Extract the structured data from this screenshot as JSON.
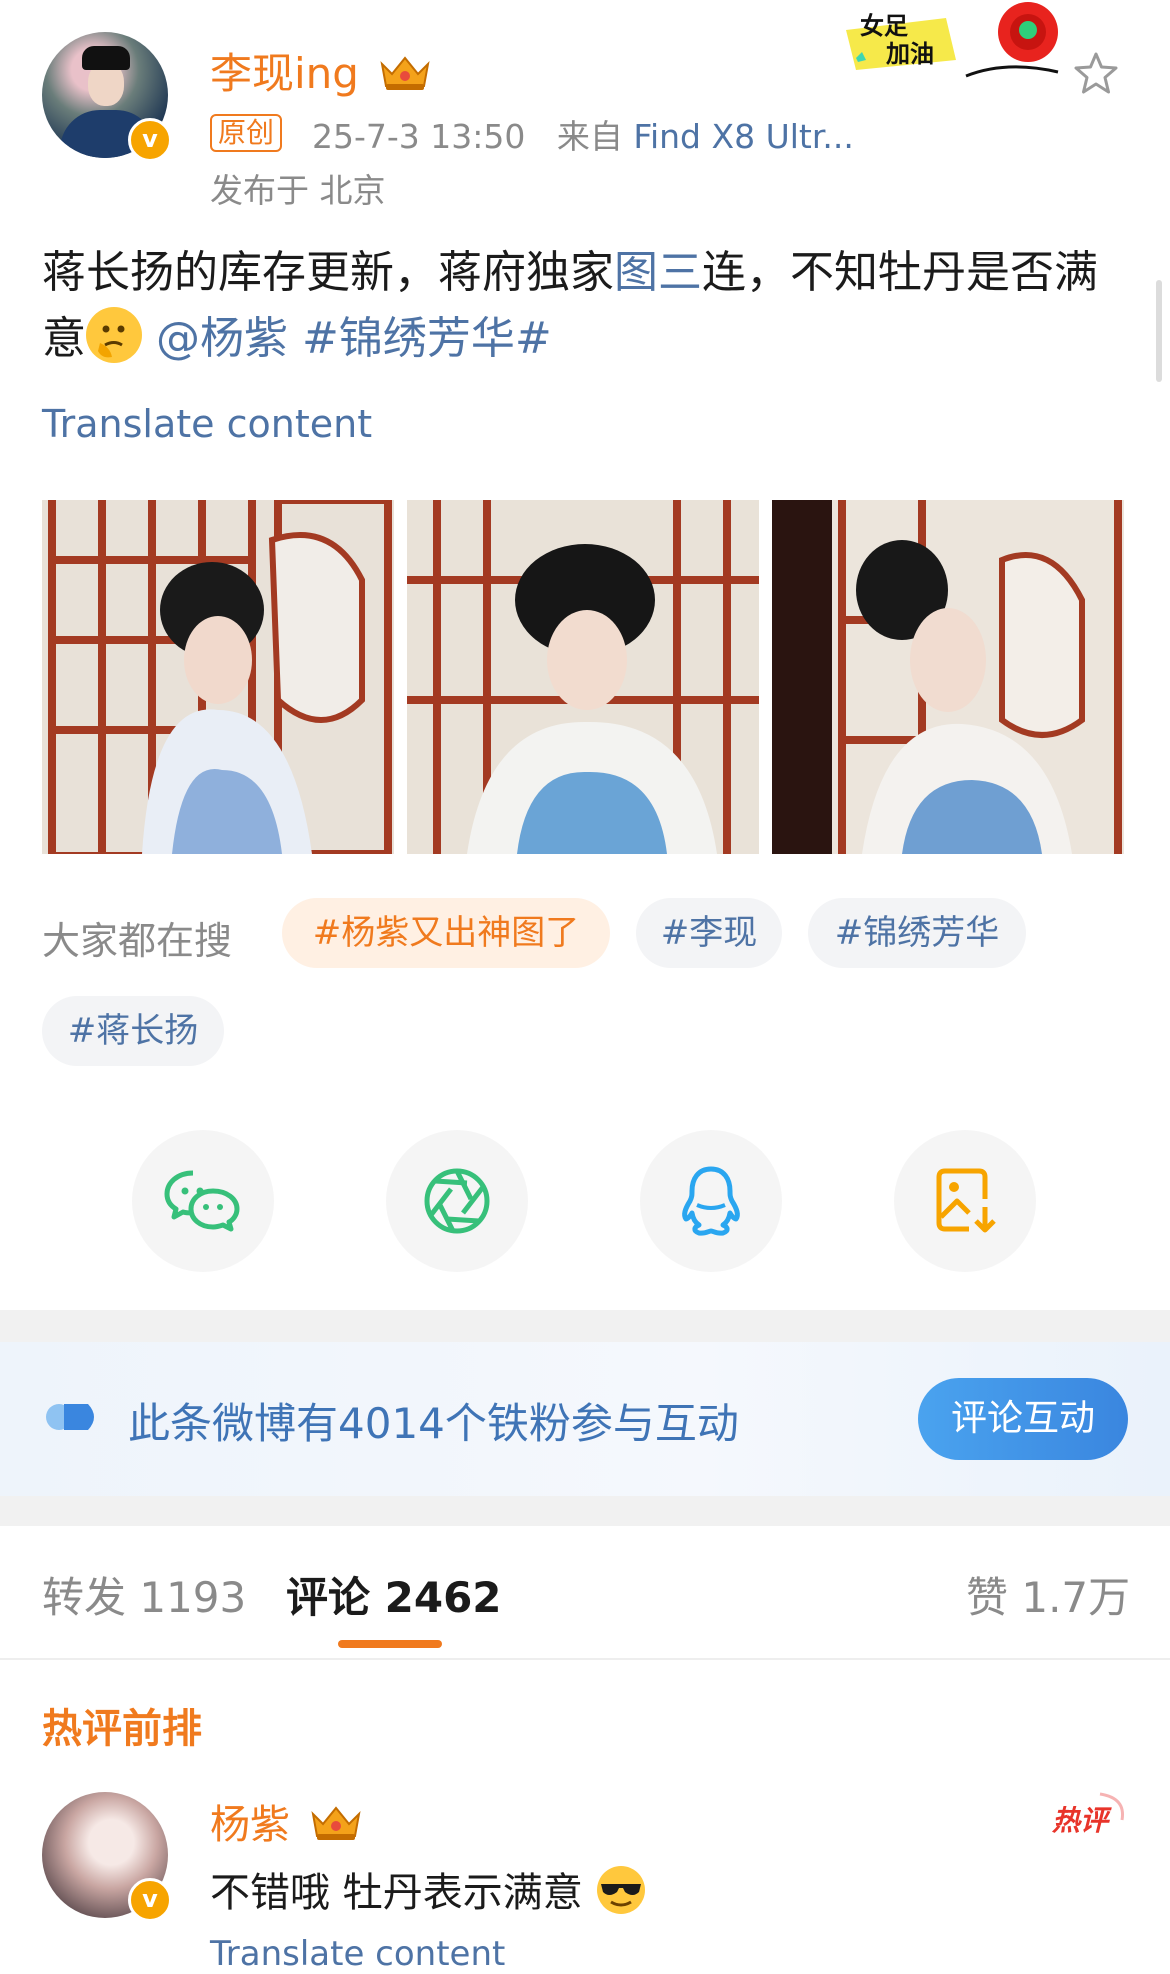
{
  "post": {
    "author": "李现ing",
    "original_label": "原创",
    "time": "25-7-3 13:50",
    "source_prefix": "来自",
    "device": "Find X8 Ultr...",
    "location": "发布于 北京",
    "text_part1": "蒋长扬的库存更新，蒋府独家",
    "text_link": "图三",
    "text_part2": "连，不知牡丹是否满意",
    "mention": "@杨紫",
    "hashtag": "#锦绣芳华#",
    "translate": "Translate content",
    "sticker_line1": "女足",
    "sticker_line2": "加油"
  },
  "search": {
    "lead": "大家都在搜",
    "chips": [
      "#杨紫又出神图了",
      "#李现",
      "#锦绣芳华",
      "#蒋长扬"
    ]
  },
  "share_icons": [
    "wechat-icon",
    "moments-icon",
    "qq-icon",
    "save-image-icon"
  ],
  "fans": {
    "text": "此条微博有4014个铁粉参与互动",
    "button": "评论互动"
  },
  "tabs": {
    "repost": "转发 1193",
    "comment": "评论 2462",
    "like": "赞 1.7万"
  },
  "comments": {
    "section_title": "热评前排",
    "items": [
      {
        "user": "杨紫",
        "text": "不错哦 牡丹表示满意",
        "tag": "热评",
        "translate": "Translate content"
      }
    ]
  },
  "colors": {
    "accent": "#f07a1e",
    "link": "#4e73a5",
    "button_blue": "#3a86df"
  }
}
